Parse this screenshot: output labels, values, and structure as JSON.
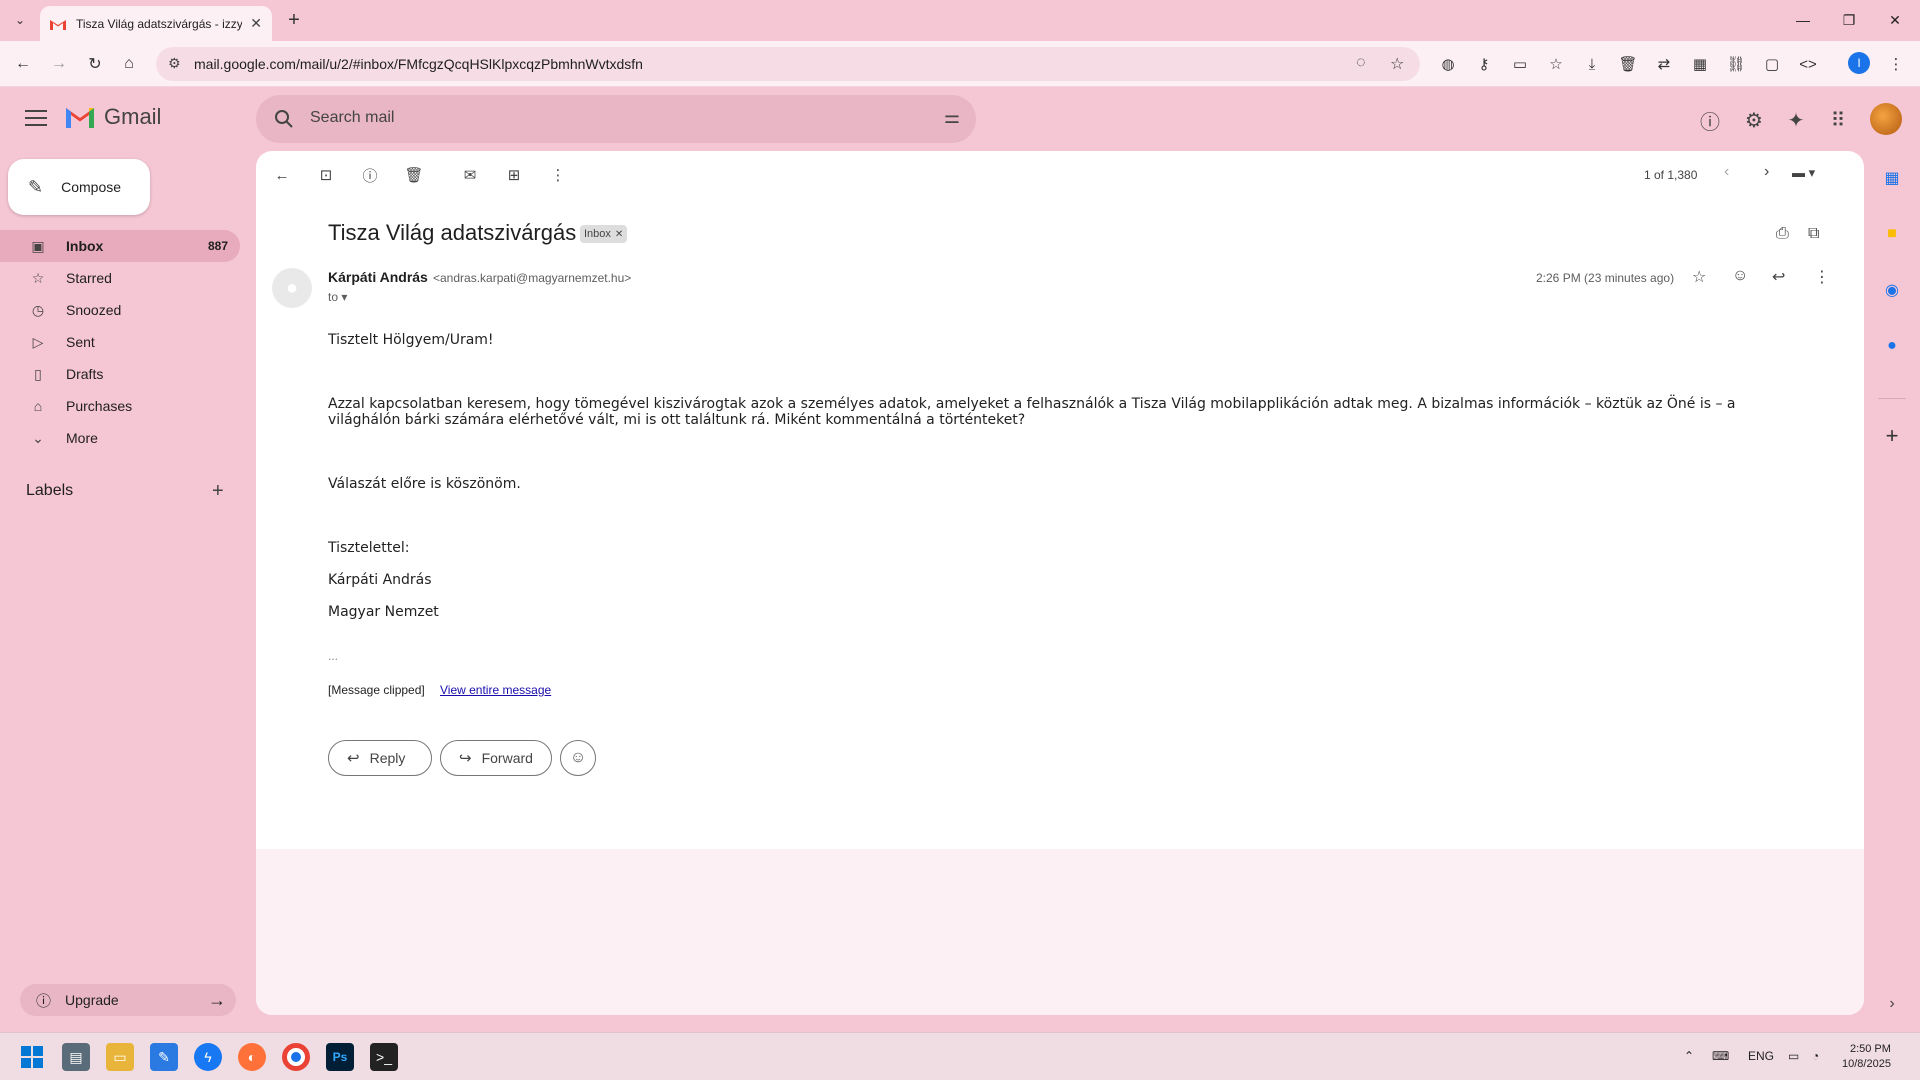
{
  "browser": {
    "tab_title": "Tisza Világ adatszivárgás - izzy",
    "url": "mail.google.com/mail/u/2/#inbox/FMfcgzQcqHSlKlpxcqzPbmhnWvtxdsfn",
    "profile_initial": "I"
  },
  "gmail": {
    "logo_text": "Gmail",
    "search_placeholder": "Search mail"
  },
  "sidebar": {
    "compose_label": "Compose",
    "items": [
      {
        "label": "Inbox",
        "count": "887"
      },
      {
        "label": "Starred"
      },
      {
        "label": "Snoozed"
      },
      {
        "label": "Sent"
      },
      {
        "label": "Drafts"
      },
      {
        "label": "Purchases"
      },
      {
        "label": "More"
      }
    ],
    "labels_heading": "Labels",
    "upgrade_label": "Upgrade"
  },
  "toolbar": {
    "pager": "1 of 1,380"
  },
  "email": {
    "subject": "Tisza Világ adatszivárgás",
    "label_chip": "Inbox",
    "sender_name": "Kárpáti András",
    "sender_email": "<andras.karpati@magyarnemzet.hu>",
    "to": "to",
    "time": "2:26 PM (23 minutes ago)",
    "greeting": "Tisztelt Hölgyem/Uram!",
    "paragraph": "Azzal kapcsolatban keresem, hogy tömegével kiszivárogtak azok a személyes adatok, amelyeket a felhasználók a Tisza Világ mobilapplikáción adtak meg. A bizalmas információk – köztük az Öné is – a világhálón bárki számára elérhetővé vált, mi is ott találtunk rá. Miként kommentálná a történteket?",
    "thanks": "Válaszát előre is köszönöm.",
    "closing": "Tisztelettel:",
    "signature_name": "Kárpáti András",
    "signature_org": "Magyar Nemzet",
    "ellipsis": "...",
    "clipped": "[Message clipped]",
    "view_entire": "View entire message",
    "reply_label": "Reply",
    "forward_label": "Forward"
  },
  "taskbar": {
    "lang": "ENG",
    "time": "2:50 PM",
    "date": "10/8/2025"
  },
  "colors": {
    "background": "#f5c6d3",
    "active_nav": "#e8aabd",
    "gmail_red": "#ea4335"
  }
}
